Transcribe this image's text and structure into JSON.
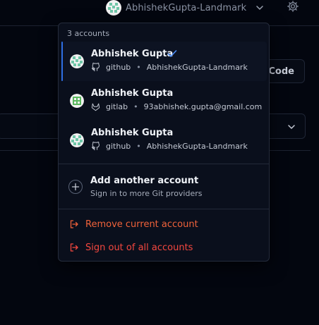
{
  "topbar": {
    "account_name": "AbhishekGupta-Landmark"
  },
  "background": {
    "code_button_label": "Code"
  },
  "menu": {
    "header": "3 accounts",
    "accounts": [
      {
        "name": "Abhishek Gupta",
        "provider": "github",
        "identifier": "AbhishekGupta-Landmark",
        "provider_icon": "github-icon",
        "active": true
      },
      {
        "name": "Abhishek Gupta",
        "provider": "gitlab",
        "identifier": "93abhishek.gupta@gmail.com",
        "provider_icon": "gitlab-icon",
        "active": false
      },
      {
        "name": "Abhishek Gupta",
        "provider": "github",
        "identifier": "AbhishekGupta-Landmark",
        "provider_icon": "github-icon",
        "active": false
      }
    ],
    "separator": "•",
    "add_account": {
      "title": "Add another account",
      "subtitle": "Sign in to more Git providers"
    },
    "remove_current": "Remove current account",
    "sign_out_all": "Sign out of all accounts"
  },
  "colors": {
    "accent": "#2f6fe4",
    "remove": "#f0623a",
    "sign_out": "#f4473f"
  }
}
